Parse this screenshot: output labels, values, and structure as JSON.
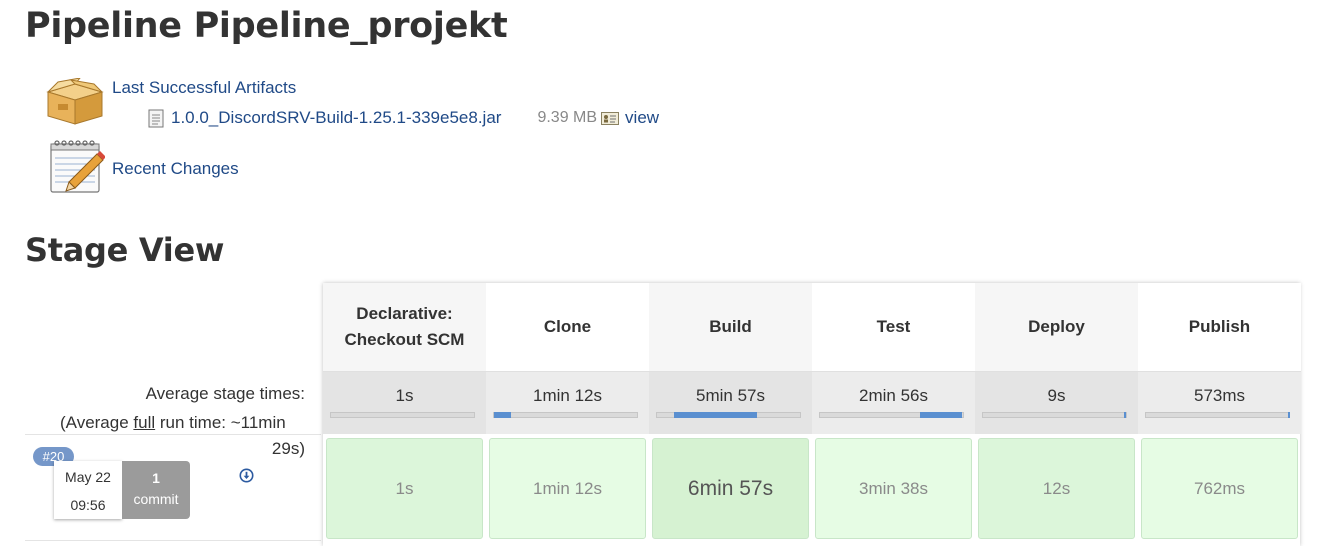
{
  "page": {
    "title": "Pipeline Pipeline_projekt"
  },
  "artifacts": {
    "label": "Last Successful Artifacts",
    "icon": "package-box-icon",
    "file": {
      "name": "1.0.0_DiscordSRV-Build-1.25.1-339e5e8.jar",
      "size": "9.39 MB",
      "view_label": "view",
      "icon": "file-icon"
    }
  },
  "recent_changes": {
    "label": "Recent Changes",
    "icon": "notepad-pencil-icon"
  },
  "stage_view": {
    "title": "Stage View",
    "avg_label": "Average stage times:",
    "avg_full_prefix": "(Average ",
    "avg_full_word": "full",
    "avg_full_suffix": " run time: ~11min",
    "avg_full_line2": "29s)",
    "stages": [
      {
        "name_line1": "Declarative:",
        "name_line2": "Checkout SCM",
        "avg": "1s",
        "fill": 0.0,
        "fill_start": 0.0,
        "run": "1s"
      },
      {
        "name_line1": "Clone",
        "name_line2": "",
        "avg": "1min 12s",
        "fill": 0.12,
        "fill_start": 0.0,
        "run": "1min 12s"
      },
      {
        "name_line1": "Build",
        "name_line2": "",
        "avg": "5min 57s",
        "fill": 0.58,
        "fill_start": 0.12,
        "run": "6min 57s"
      },
      {
        "name_line1": "Test",
        "name_line2": "",
        "avg": "2min 56s",
        "fill": 0.29,
        "fill_start": 0.7,
        "run": "3min 38s"
      },
      {
        "name_line1": "Deploy",
        "name_line2": "",
        "avg": "9s",
        "fill": 0.015,
        "fill_start": 0.985,
        "run": "12s"
      },
      {
        "name_line1": "Publish",
        "name_line2": "",
        "avg": "573ms",
        "fill": 0.01,
        "fill_start": 0.99,
        "run": "762ms"
      }
    ],
    "run": {
      "build_number": "#20",
      "date": "May 22",
      "time": "09:56",
      "commit_count": "1",
      "commit_label": "commit"
    }
  },
  "colors": {
    "link": "#204a87",
    "success_cell": "#dcf6da",
    "badge": "#7597c9",
    "progress": "#5a8fd0"
  }
}
